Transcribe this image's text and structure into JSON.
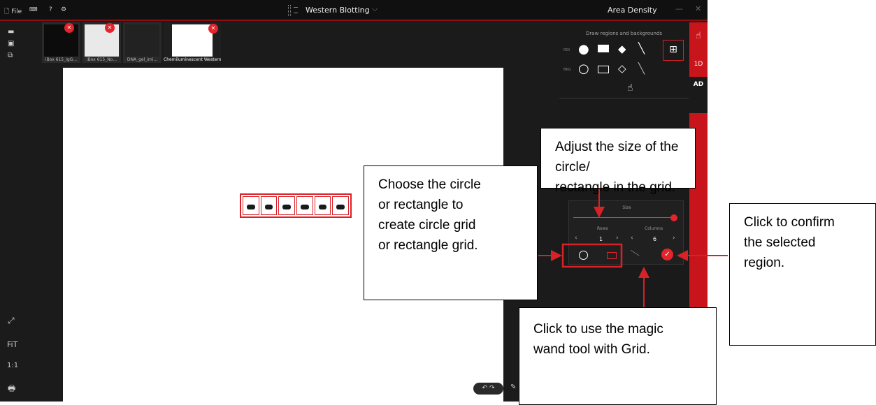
{
  "titlebar": {
    "file_label": "File",
    "help_label": "?",
    "center_title": "Western Blotting",
    "right_title": "Area Density",
    "minimize": "—",
    "close": "✕"
  },
  "left_toolbar": {
    "fit_label": "FiT",
    "one_to_one_label": "1:1"
  },
  "thumbnails": [
    {
      "label": "iBox 615_IgG..."
    },
    {
      "label": "iBox 615_No..."
    },
    {
      "label": "DNA_gel_imi..."
    },
    {
      "label": "Chemiluminescent Western Blot"
    }
  ],
  "right_panel": {
    "draw_label": "Draw regions and backgrounds",
    "roi_label": "ROI",
    "bkg_label": "BKG",
    "tabs": [
      "1D",
      "AD"
    ]
  },
  "grid_panel": {
    "size_label": "Size",
    "size_value": 1.0,
    "rows_label": "Rows",
    "columns_label": "Columns",
    "rows_value": "1",
    "columns_value": "6",
    "selected_shape": "rectangle"
  },
  "bands": {
    "count": 6
  },
  "callouts": {
    "adjust": [
      "Adjust the size of the circle/",
      "rectangle in the grid."
    ],
    "choose": [
      "Choose the circle",
      "or rectangle to",
      "create circle grid",
      "or rectangle grid."
    ],
    "confirm": [
      "Click to confirm",
      "the selected",
      "region."
    ],
    "magic": [
      "Click to use the magic",
      "wand tool with Grid."
    ]
  },
  "colors": {
    "accent": "#d92128",
    "background": "#1b1b1b"
  }
}
